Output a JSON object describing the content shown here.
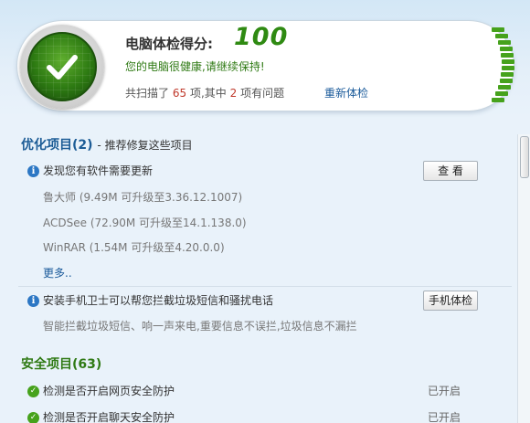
{
  "header": {
    "score_label": "电脑体检得分:",
    "score_value": "100",
    "health_message": "您的电脑很健康,请继续保持!",
    "summary_prefix": "共扫描了",
    "scanned_count": "65",
    "summary_middle": "项,其中",
    "problem_count": "2",
    "summary_suffix": "项有问题",
    "recheck_link": "重新体检"
  },
  "optimize": {
    "title": "优化项目(2)",
    "subtitle": "- 推荐修复这些项目",
    "software_update": {
      "label": "发现您有软件需要更新",
      "button": "查 看",
      "items": [
        "鲁大师 (9.49M 可升级至3.36.12.1007)",
        "ACDSee (72.90M 可升级至14.1.138.0)",
        "WinRAR (1.54M 可升级至4.20.0.0)"
      ],
      "more_link": "更多.."
    },
    "phone_guard": {
      "label": "安装手机卫士可以帮您拦截垃圾短信和骚扰电话",
      "button": "手机体检",
      "description": "智能拦截垃圾短信、响一声来电,重要信息不误拦,垃圾信息不漏拦"
    }
  },
  "security": {
    "title": "安全项目(63)",
    "items": [
      {
        "label": "检测是否开启网页安全防护",
        "status": "已开启"
      },
      {
        "label": "检测是否开启聊天安全防护",
        "status": "已开启"
      }
    ]
  },
  "colors": {
    "score_green": "#2f8a12",
    "section_blue": "#1c5c96",
    "link_blue": "#1a5a9a",
    "problem_red": "#c0392b"
  },
  "icons": {
    "score_badge": "check-mark-icon",
    "info": "info-icon",
    "ok": "ok-check-icon"
  }
}
